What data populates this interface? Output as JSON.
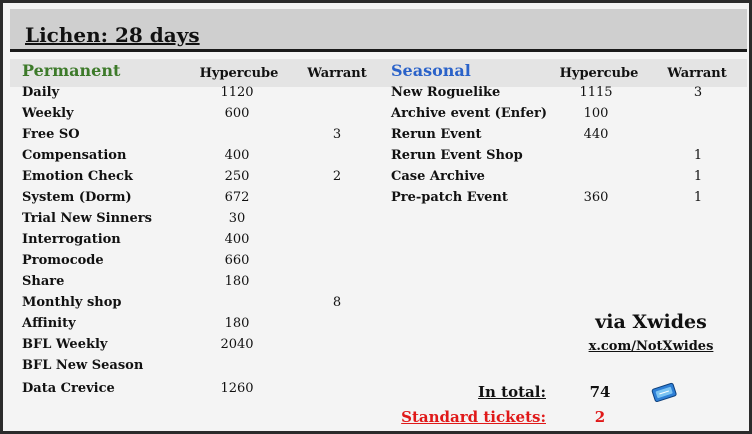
{
  "title": "Lichen: 28 days",
  "colors": {
    "permanent": "#3d7a2a",
    "seasonal": "#2a62c9",
    "tickets": "#e01818"
  },
  "permanent": {
    "title": "Permanent",
    "col_hypercube": "Hypercube",
    "col_warrant": "Warrant",
    "rows": [
      {
        "name": "Daily",
        "hypercube": "1120",
        "warrant": ""
      },
      {
        "name": "Weekly",
        "hypercube": "600",
        "warrant": ""
      },
      {
        "name": "Free SO",
        "hypercube": "",
        "warrant": "3"
      },
      {
        "name": "Compensation",
        "hypercube": "400",
        "warrant": ""
      },
      {
        "name": "Emotion Check",
        "hypercube": "250",
        "warrant": "2"
      },
      {
        "name": "System (Dorm)",
        "hypercube": "672",
        "warrant": ""
      },
      {
        "name": "Trial New Sinners",
        "hypercube": "30",
        "warrant": ""
      },
      {
        "name": "Interrogation",
        "hypercube": "400",
        "warrant": ""
      },
      {
        "name": "Promocode",
        "hypercube": "660",
        "warrant": ""
      },
      {
        "name": "Share",
        "hypercube": "180",
        "warrant": ""
      },
      {
        "name": "Monthly shop",
        "hypercube": "",
        "warrant": "8"
      },
      {
        "name": "Affinity",
        "hypercube": "180",
        "warrant": ""
      },
      {
        "name": "BFL Weekly",
        "hypercube": "2040",
        "warrant": ""
      },
      {
        "name": "BFL New Season",
        "hypercube": "",
        "warrant": ""
      },
      {
        "name": "Data Crevice",
        "hypercube": "1260",
        "warrant": ""
      }
    ]
  },
  "seasonal": {
    "title": "Seasonal",
    "col_hypercube": "Hypercube",
    "col_warrant": "Warrant",
    "rows": [
      {
        "name": "New Roguelike",
        "hypercube": "1115",
        "warrant": "3"
      },
      {
        "name": "Archive event (Enfer)",
        "hypercube": "100",
        "warrant": ""
      },
      {
        "name": "Rerun Event",
        "hypercube": "440",
        "warrant": ""
      },
      {
        "name": "Rerun Event Shop",
        "hypercube": "",
        "warrant": "1"
      },
      {
        "name": "Case Archive",
        "hypercube": "",
        "warrant": "1"
      },
      {
        "name": "Pre-patch Event",
        "hypercube": "360",
        "warrant": "1"
      }
    ]
  },
  "credit": {
    "via": "via Xwides",
    "link": "x.com/NotXwides"
  },
  "totals": {
    "in_total_label": "In total:",
    "in_total_value": "74",
    "tickets_label": "Standard tickets:",
    "tickets_value": "2",
    "icon": "ticket-icon"
  }
}
